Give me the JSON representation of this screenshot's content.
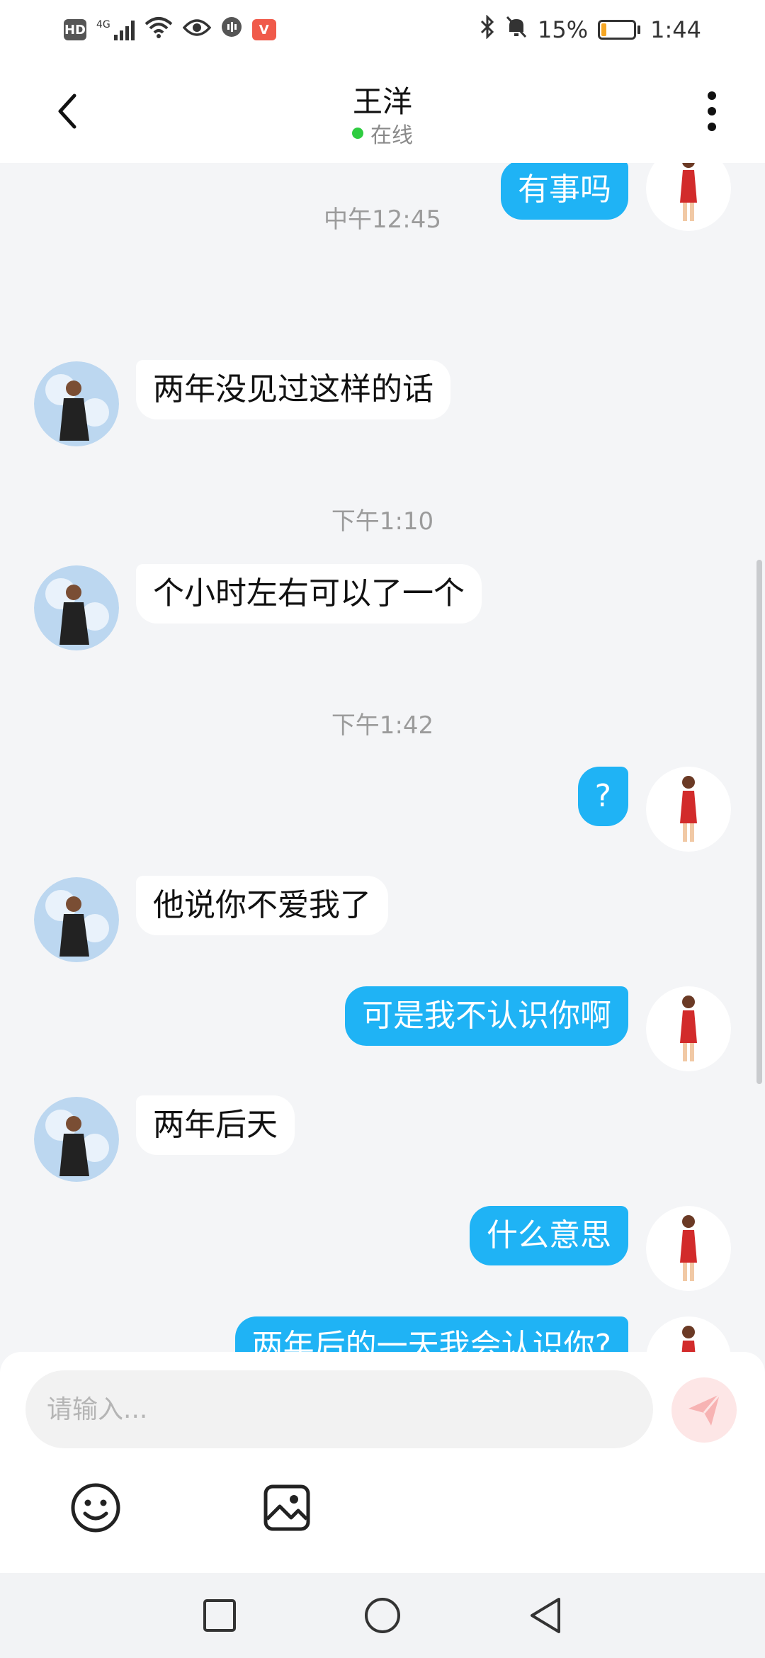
{
  "status_bar": {
    "network": "4G",
    "hd_label": "HD",
    "app_badge": "V",
    "battery": "15%",
    "battery_level": 0.15,
    "time": "1:44",
    "icons": [
      "hd-icon",
      "signal-icon",
      "wifi-icon",
      "eye-icon",
      "voice-icon",
      "app-badge-icon",
      "bluetooth-icon",
      "mute-icon",
      "battery-icon"
    ]
  },
  "header": {
    "title": "王洋",
    "presence": "在线",
    "presence_color": "#2ecc40"
  },
  "messages": [
    {
      "from": "me",
      "text": "有事吗"
    },
    {
      "timestamp": "中午12:45"
    },
    {
      "from": "them",
      "text": "两年没见过这样的话"
    },
    {
      "timestamp": "下午1:10"
    },
    {
      "from": "them",
      "text": "个小时左右可以了一个"
    },
    {
      "timestamp": "下午1:42"
    },
    {
      "from": "me",
      "text": "?"
    },
    {
      "from": "them",
      "text": "他说你不爱我了"
    },
    {
      "from": "me",
      "text": "可是我不认识你啊"
    },
    {
      "from": "them",
      "text": "两年后天"
    },
    {
      "from": "me",
      "text": "什么意思"
    },
    {
      "from": "me",
      "text": "两年后的一天我会认识你?"
    }
  ],
  "composer": {
    "placeholder": "请输入...",
    "send_icon": "send-icon",
    "tools": [
      "emoji-icon",
      "image-icon"
    ]
  },
  "colors": {
    "outgoing_bubble": "#1fb3f5",
    "incoming_bubble": "#ffffff",
    "background": "#f4f5f7"
  }
}
